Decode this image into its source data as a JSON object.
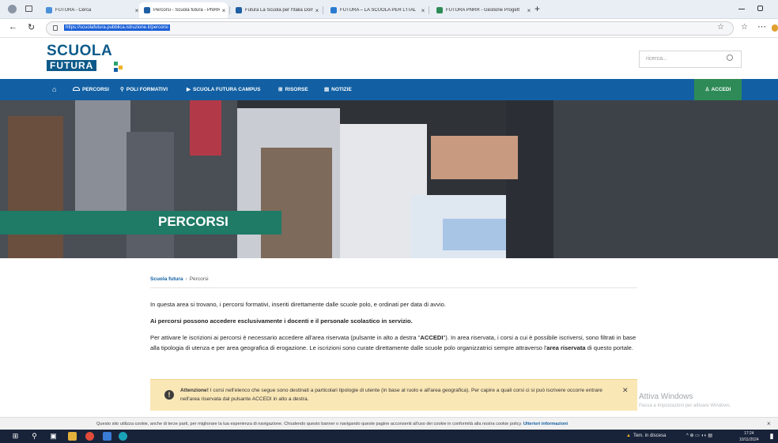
{
  "browser": {
    "tabs": [
      {
        "title": "FUTURA - Cerca",
        "active": false,
        "color": "#4a90d9"
      },
      {
        "title": "Percorsi - Scuola futura - PNRR",
        "active": true,
        "color": "#1f5fa3"
      },
      {
        "title": "Futura La Scuola per l'Italia Domá",
        "active": false,
        "color": "#1f5fa3"
      },
      {
        "title": "FUTURA – LA SCUOLA PER L'ITAL",
        "active": false,
        "color": "#2a7bd0"
      },
      {
        "title": "FUTURA PNRR - Gestione Progett",
        "active": false,
        "color": "#2e8b57"
      }
    ],
    "new_tab": "+",
    "url": "https://scuolafutura.pubblica.istruzione.it/percorsi"
  },
  "site": {
    "logo_line1": "SCUOLA",
    "logo_line2": "FUTURA",
    "search_placeholder": "ricerca...",
    "nav": {
      "home_icon": "⌂",
      "items": [
        "PERCORSI",
        "POLI FORMATIVI",
        "SCUOLA FUTURA CAMPUS",
        "RISORSE",
        "NOTIZIE"
      ],
      "login": "ACCEDI"
    },
    "hero_title": "PERCORSI",
    "breadcrumb": {
      "home": "Scuola futura",
      "sep": "›",
      "current": "Percorsi"
    },
    "intro": "In questa area si trovano, i percorsi formativi, inseriti direttamente dalle scuole polo, e ordinati per data di avvio.",
    "access_note": "Ai percorsi possono accedere esclusivamente i docenti e il personale scolastico in servizio.",
    "instructions": {
      "a": "Per attivare le iscrizioni ai percorsi è necessario accedere all'area riservata (pulsante in alto a destra \"",
      "b": "ACCEDI",
      "c": "\"). In area riservata, i corsi a cui è possibile iscriversi, sono filtrati in base alla tipologia di utenza e per area geografica di erogazione. Le iscrizioni sono curate direttamente dalle scuole polo organizzatrici sempre attraverso l'",
      "d": "area riservata",
      "e": " di questo portale."
    },
    "alert": {
      "bold": "Attenzione!",
      "text": " I corsi nell'elenco che segue sono destinati a particolari tipologie di utente (in base al ruolo e all'area geografica). Per capire a quali corsi ci si può iscrivere occorre entrare nell'area riservata dal pulsante ACCEDI in alto a destra.",
      "close": "✕"
    },
    "cookie": {
      "text": "Questo sito utilizza cookie, anche di terze parti, per migliorare la tua esperienza di navigazione. Chiudendo questo banner o navigando queste pagine acconsenti all'uso dei cookie in conformità alla nostra cookie policy. ",
      "link": "Ulteriori informazioni",
      "close": "×"
    }
  },
  "watermark": {
    "line1": "Attiva Windows",
    "line2": "Passa a Impostazioni per attivare Windows."
  },
  "taskbar": {
    "status": "Tem. in discesa",
    "time": "17:24",
    "date": "10/11/2024"
  },
  "colors": {
    "primary": "#1260a3",
    "login": "#2e8b57",
    "hero_band": "#1f7a66",
    "alert_bg": "#fae7b6"
  }
}
